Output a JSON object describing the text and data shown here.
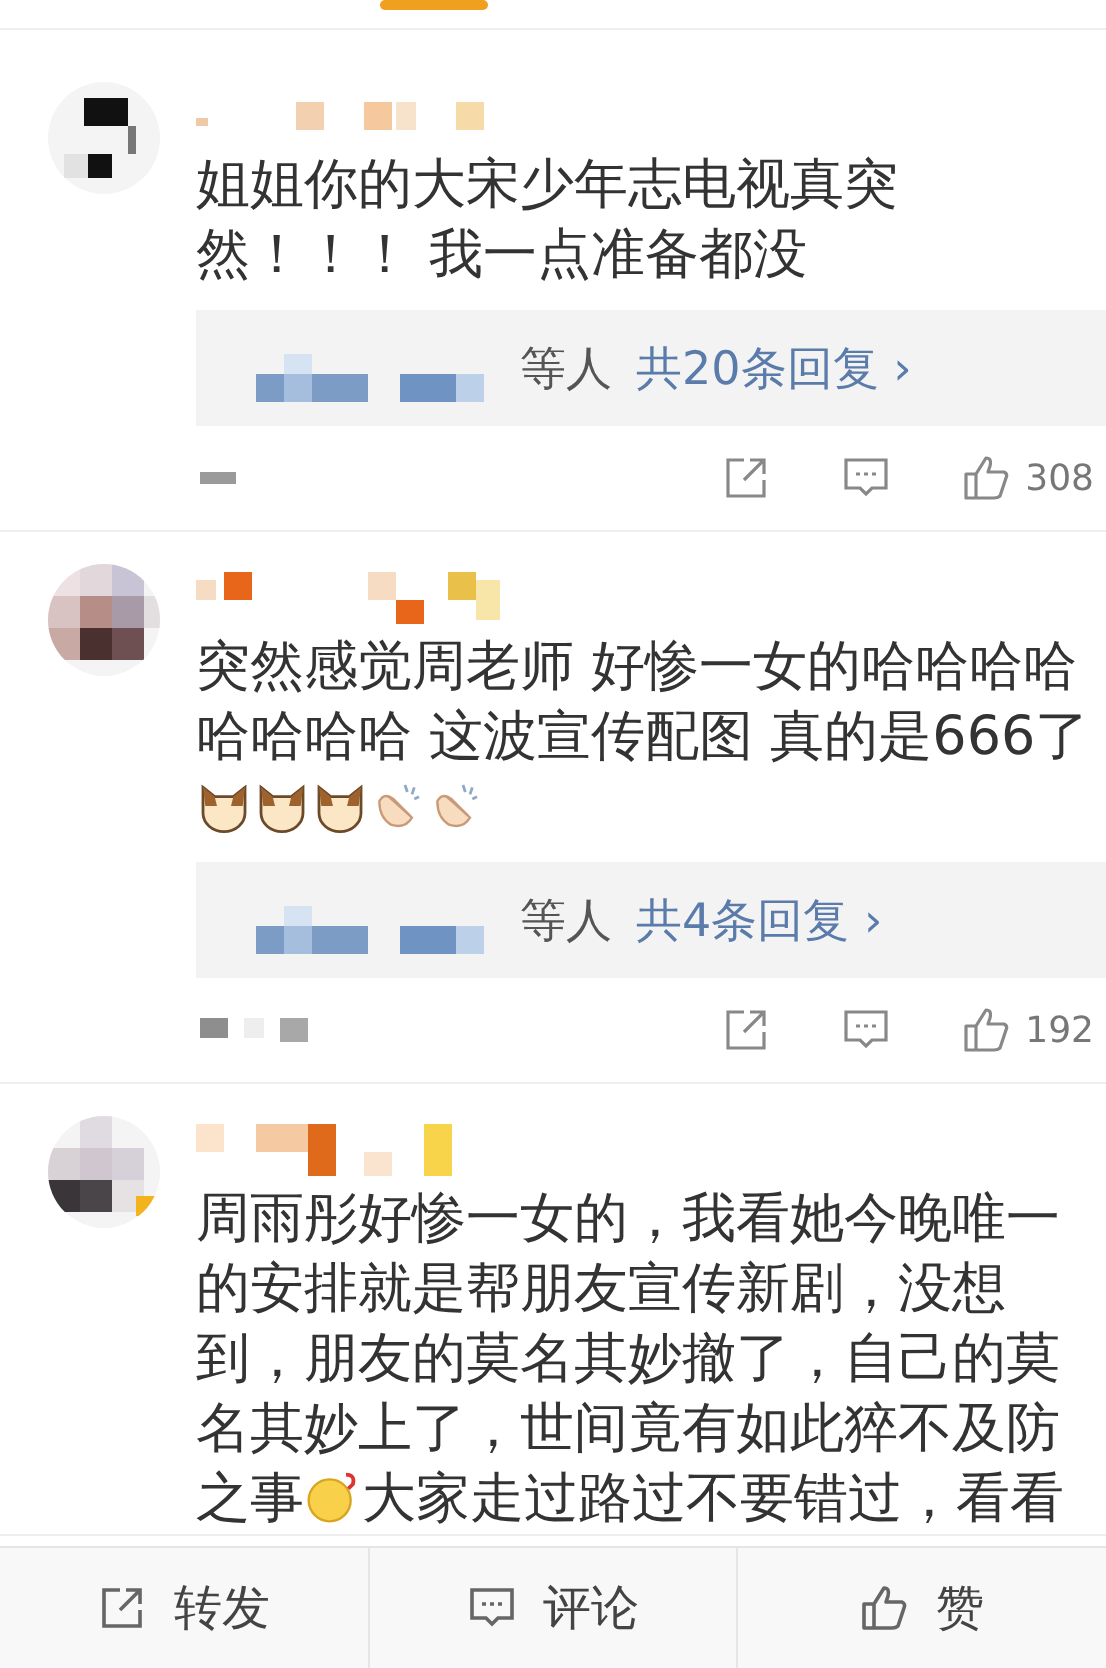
{
  "comments": [
    {
      "body": [
        {
          "kind": "text",
          "text": "姐姐你的大宋少年志电视真突然！！！ 我一点准备都没"
        }
      ],
      "replies": {
        "suffix": "等人",
        "link": "共20条回复",
        "chevron": "›"
      },
      "likes": "308"
    },
    {
      "body": [
        {
          "kind": "text",
          "text": "突然感觉周老师 好惨一女的哈哈哈哈哈哈哈哈 这波宣传配图 真的是666了"
        },
        {
          "kind": "cat"
        },
        {
          "kind": "cat"
        },
        {
          "kind": "cat"
        },
        {
          "kind": "clap"
        },
        {
          "kind": "clap"
        }
      ],
      "replies": {
        "suffix": "等人",
        "link": "共4条回复",
        "chevron": "›"
      },
      "likes": "192"
    },
    {
      "body": [
        {
          "kind": "text",
          "text": "周雨彤好惨一女的，我看她今晚唯一的安排就是帮朋友宣传新剧，没想到，朋友的莫名其妙撤了，自己的莫名其妙上了，世间竟有如此猝不及防之事"
        },
        {
          "kind": "puzzled"
        },
        {
          "kind": "text",
          "text": "大家走过路过不要错过，看看"
        }
      ]
    }
  ],
  "bottom_bar": [
    {
      "kind": "repost",
      "label": "转发"
    },
    {
      "kind": "comment",
      "label": "评论"
    },
    {
      "kind": "like",
      "label": "赞"
    }
  ]
}
